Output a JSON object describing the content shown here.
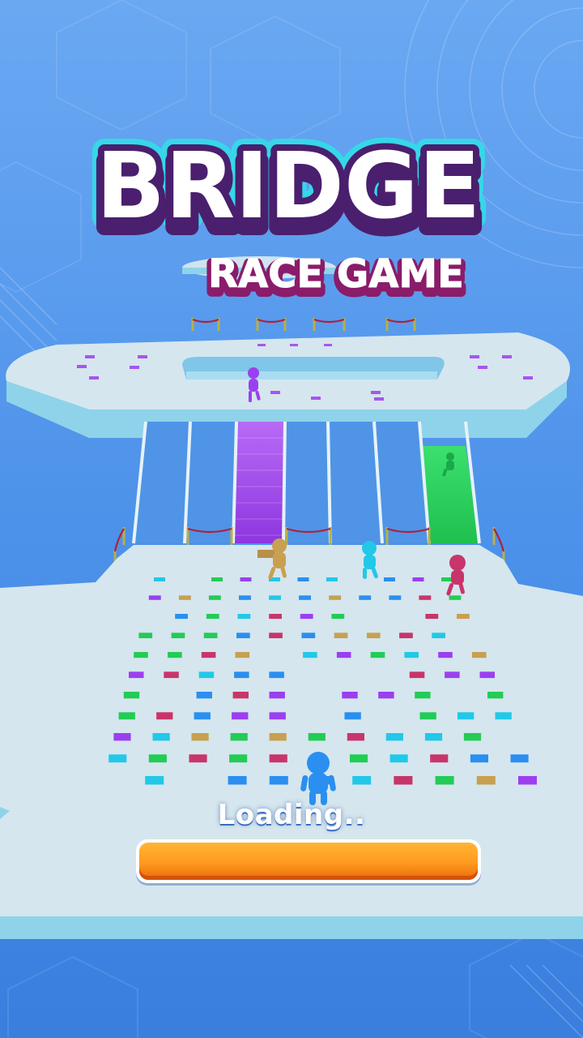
{
  "title": {
    "main": "BRIDGE",
    "sub": "RACE GAME"
  },
  "loading": {
    "label": "Loading..",
    "progress": 1.0
  },
  "colors": {
    "background": "#4a8fe6",
    "platform": "#d5e6ee",
    "platform_edge": "#8fd3ea",
    "title_fill": "#ffffff",
    "title_outline": "#4a1f6e",
    "title_glow": "#37d6e8",
    "subtitle_fill": "#ffffff",
    "subtitle_outline": "#8a1c6a",
    "progress_fill": "#ff9a1f",
    "purple": "#9b3ff0",
    "green": "#22cc55",
    "blue": "#2a8ff0",
    "cyan": "#22c8e8",
    "crimson": "#c8356a",
    "tan": "#c8a050"
  },
  "players": [
    {
      "name": "purple-runner",
      "color": "#9b3ff0"
    },
    {
      "name": "tan-runner",
      "color": "#c8a050"
    },
    {
      "name": "cyan-runner",
      "color": "#22c8e8"
    },
    {
      "name": "crimson-runner",
      "color": "#c8356a"
    },
    {
      "name": "blue-player",
      "color": "#2a8ff0"
    }
  ]
}
